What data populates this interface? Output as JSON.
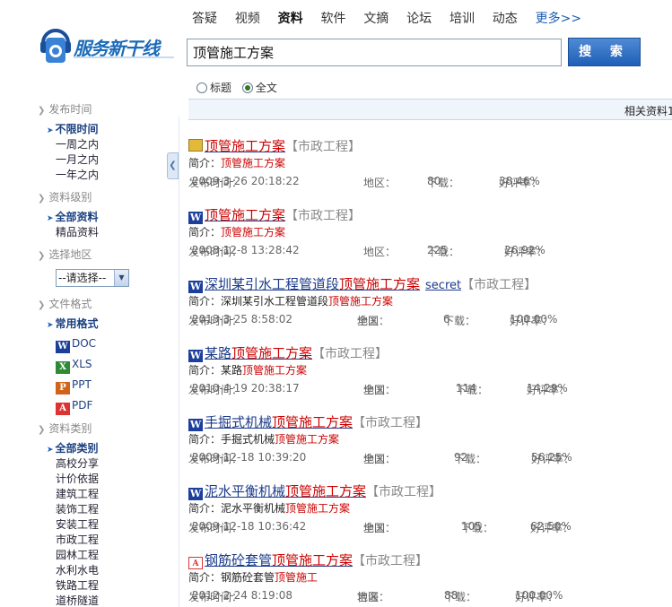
{
  "nav": {
    "items": [
      "答疑",
      "视频",
      "资料",
      "软件",
      "文摘",
      "论坛",
      "培训",
      "动态",
      "更多>>"
    ],
    "active": "资料"
  },
  "logo": {
    "text": "服务新干线"
  },
  "search": {
    "value": "顶管施工方案",
    "button": "搜 索"
  },
  "scope": {
    "title": "标题",
    "fulltext": "全文",
    "selected": "全文"
  },
  "result_bar": {
    "text": "相关资料1"
  },
  "sidebar": {
    "time": {
      "heading": "发布时间",
      "items": [
        "不限时间",
        "一周之内",
        "一月之内",
        "一年之内"
      ]
    },
    "level": {
      "heading": "资料级别",
      "items": [
        "全部资料",
        "精品资料"
      ]
    },
    "region": {
      "heading": "选择地区",
      "select": "--请选择--"
    },
    "format": {
      "heading": "文件格式",
      "selected": "常用格式",
      "items": [
        "DOC",
        "XLS",
        "PPT",
        "PDF"
      ]
    },
    "category": {
      "heading": "资料类别",
      "items": [
        "全部类别",
        "高校分享",
        "计价依据",
        "建筑工程",
        "装饰工程",
        "安装工程",
        "市政工程",
        "园林工程",
        "水利水电",
        "铁路工程",
        "道桥隧道"
      ]
    }
  },
  "labels": {
    "summary": "简介：",
    "date": "发布时间：",
    "region": "地区：",
    "downloads": "下载：",
    "rating": "好评率："
  },
  "results": [
    {
      "prefix": "",
      "highlight": "顶管施工方案",
      "extra": "",
      "tag": "【市政工程】",
      "summary_prefix": "",
      "summary_hl": "顶管施工方案",
      "date": "2009-3-26 20:18:22",
      "region": "",
      "downloads": "80",
      "rating": "38.46%",
      "icon": "misc-icon"
    },
    {
      "prefix": "",
      "highlight": "顶管施工方案",
      "extra": "",
      "tag": "【市政工程】",
      "summary_prefix": "",
      "summary_hl": "顶管施工方案",
      "date": "2008-12-8 13:28:42",
      "region": "",
      "downloads": "225",
      "rating": "26.92%",
      "icon": "word-icon"
    },
    {
      "prefix": "深圳某引水工程管道段",
      "highlight": "顶管施工方案",
      "extra": "secret",
      "tag": "【市政工程】",
      "summary_prefix": "深圳某引水工程管道段",
      "summary_hl": "顶管施工方案",
      "date": "2013-3-25 8:58:02",
      "region": "全国",
      "downloads": "6",
      "rating": "100.00%",
      "icon": "word-icon"
    },
    {
      "prefix": "某路",
      "highlight": "顶管施工方案",
      "extra": "",
      "tag": "【市政工程】",
      "summary_prefix": "某路",
      "summary_hl": "顶管施工方案",
      "date": "2010-4-19 20:38:17",
      "region": "全国",
      "downloads": "114",
      "rating": "14.29%",
      "icon": "word-icon"
    },
    {
      "prefix": "手掘式机械",
      "highlight": "顶管施工方案",
      "extra": "",
      "tag": "【市政工程】",
      "summary_prefix": "手掘式机械",
      "summary_hl": "顶管施工方案",
      "date": "2009-12-18 10:39:20",
      "region": "全国",
      "downloads": "92",
      "rating": "56.25%",
      "icon": "word-icon"
    },
    {
      "prefix": "泥水平衡机械",
      "highlight": "顶管施工方案",
      "extra": "",
      "tag": "【市政工程】",
      "summary_prefix": "泥水平衡机械",
      "summary_hl": "顶管施工方案",
      "date": "2009-12-18 10:36:42",
      "region": "全国",
      "downloads": "105",
      "rating": "62.50%",
      "icon": "word-icon"
    },
    {
      "prefix": "钢筋砼套管",
      "highlight": "顶管施工方案",
      "extra": "",
      "tag": "【市政工程】",
      "summary_prefix": "钢筋砼套管",
      "summary_hl": "顶管施工",
      "date": "2012-2-24 8:19:08",
      "region": "吉海",
      "downloads": "88",
      "rating": "100.00%",
      "icon": "pdf-icon"
    }
  ]
}
